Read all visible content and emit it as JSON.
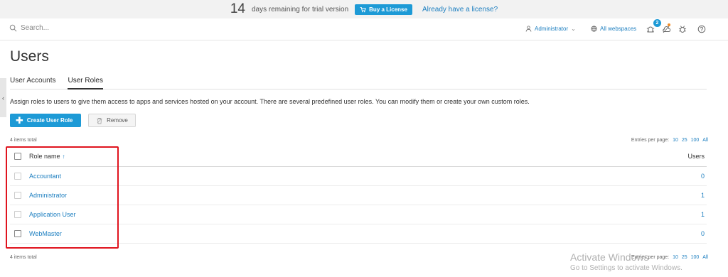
{
  "trial_banner": {
    "days": "14",
    "text": "days remaining for trial version",
    "buy_button": "Buy a License",
    "license_link": "Already have a license?"
  },
  "header": {
    "search_placeholder": "Search...",
    "user_menu": "Administrator",
    "webspaces_menu": "All webspaces",
    "notification_count": "2"
  },
  "side_tab_glyph": "‹",
  "page": {
    "title": "Users",
    "tabs": [
      {
        "label": "User Accounts",
        "active": false
      },
      {
        "label": "User Roles",
        "active": true
      }
    ],
    "description": "Assign roles to users to give them access to apps and services hosted on your account. There are several predefined user roles. You can modify them or create your own custom roles.",
    "create_button": "Create User Role",
    "remove_button": "Remove",
    "items_total_top": "4 items total",
    "items_total_bottom": "4 items total",
    "entries_label": "Entries per page:",
    "entries_options": [
      "10",
      "25",
      "100",
      "All"
    ]
  },
  "table": {
    "columns": {
      "role": "Role name",
      "users": "Users"
    },
    "sort_indicator": "↑",
    "rows": [
      {
        "name": "Accountant",
        "users": "0",
        "checkbox_enabled": false
      },
      {
        "name": "Administrator",
        "users": "1",
        "checkbox_enabled": false
      },
      {
        "name": "Application User",
        "users": "1",
        "checkbox_enabled": false
      },
      {
        "name": "WebMaster",
        "users": "0",
        "checkbox_enabled": true
      }
    ]
  },
  "watermark": {
    "title": "Activate Windows",
    "subtitle": "Go to Settings to activate Windows."
  },
  "colors": {
    "accent": "#1d9ad6",
    "link": "#1d7fc0",
    "highlight": "#e0141e"
  },
  "icons": [
    "search-icon",
    "cart-icon",
    "user-icon",
    "globe-icon",
    "bell-icon",
    "cloud-icon",
    "bug-icon",
    "help-icon",
    "trash-icon"
  ]
}
